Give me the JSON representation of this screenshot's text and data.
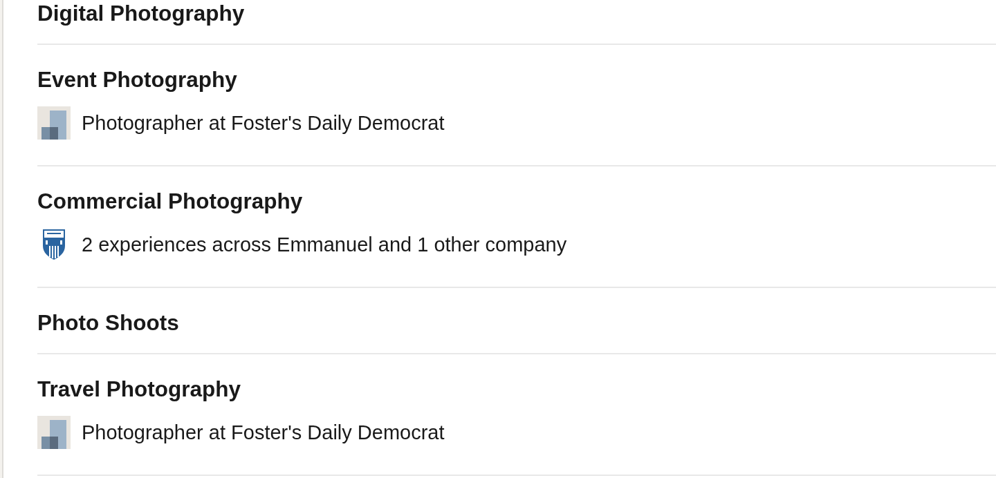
{
  "skills": [
    {
      "name": "Digital Photography"
    },
    {
      "name": "Event Photography",
      "detail": {
        "kind": "placeholder",
        "text": "Photographer at Foster's Daily Democrat"
      }
    },
    {
      "name": "Commercial Photography",
      "detail": {
        "kind": "crest",
        "text": "2 experiences across Emmanuel and 1 other company"
      }
    },
    {
      "name": "Photo Shoots"
    },
    {
      "name": "Travel Photography",
      "detail": {
        "kind": "placeholder",
        "text": "Photographer at Foster's Daily Democrat"
      }
    }
  ]
}
